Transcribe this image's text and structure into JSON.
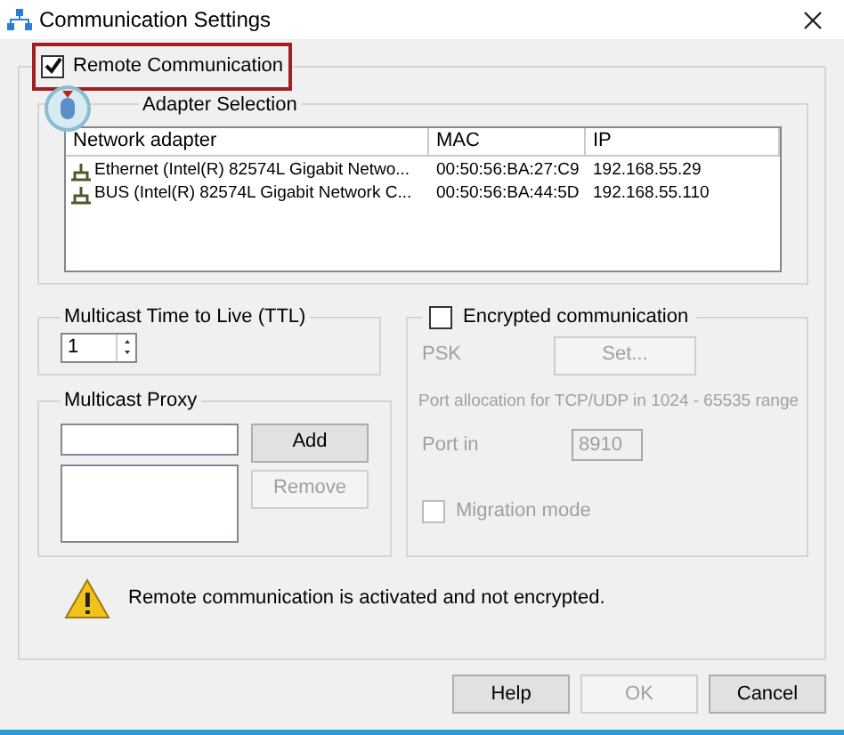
{
  "window": {
    "title": "Communication Settings"
  },
  "remote_communication": {
    "label": "Remote Communication",
    "checked": true,
    "highlighted": true
  },
  "adapter_selection": {
    "title": "Adapter Selection",
    "columns": [
      "Network adapter",
      "MAC",
      "IP"
    ],
    "rows": [
      {
        "cells": [
          "Ethernet (Intel(R) 82574L Gigabit Netwo...",
          "00:50:56:BA:27:C9",
          "192.168.55.29"
        ]
      },
      {
        "cells": [
          "BUS (Intel(R) 82574L Gigabit Network C...",
          "00:50:56:BA:44:5D",
          "192.168.55.110"
        ]
      }
    ]
  },
  "ttl": {
    "title": "Multicast Time to Live (TTL)",
    "value": "1"
  },
  "proxy": {
    "title": "Multicast Proxy",
    "buttons": [
      {
        "label": "Add",
        "disabled": false
      },
      {
        "label": "Remove",
        "disabled": true
      }
    ]
  },
  "encryption": {
    "label": "Encrypted communication",
    "checked": false,
    "disabled": true,
    "psk_label": "PSK",
    "set_button": "Set...",
    "port_note": "Port allocation for TCP/UDP in 1024 - 65535 range",
    "port_label": "Port in",
    "port_value": "8910",
    "migration": {
      "label": "Migration mode",
      "checked": false
    }
  },
  "warning": {
    "text": "Remote communication is activated and not encrypted."
  },
  "buttons": [
    {
      "label": "Help",
      "disabled": false
    },
    {
      "label": "OK",
      "disabled": true
    },
    {
      "label": "Cancel",
      "disabled": false
    }
  ]
}
